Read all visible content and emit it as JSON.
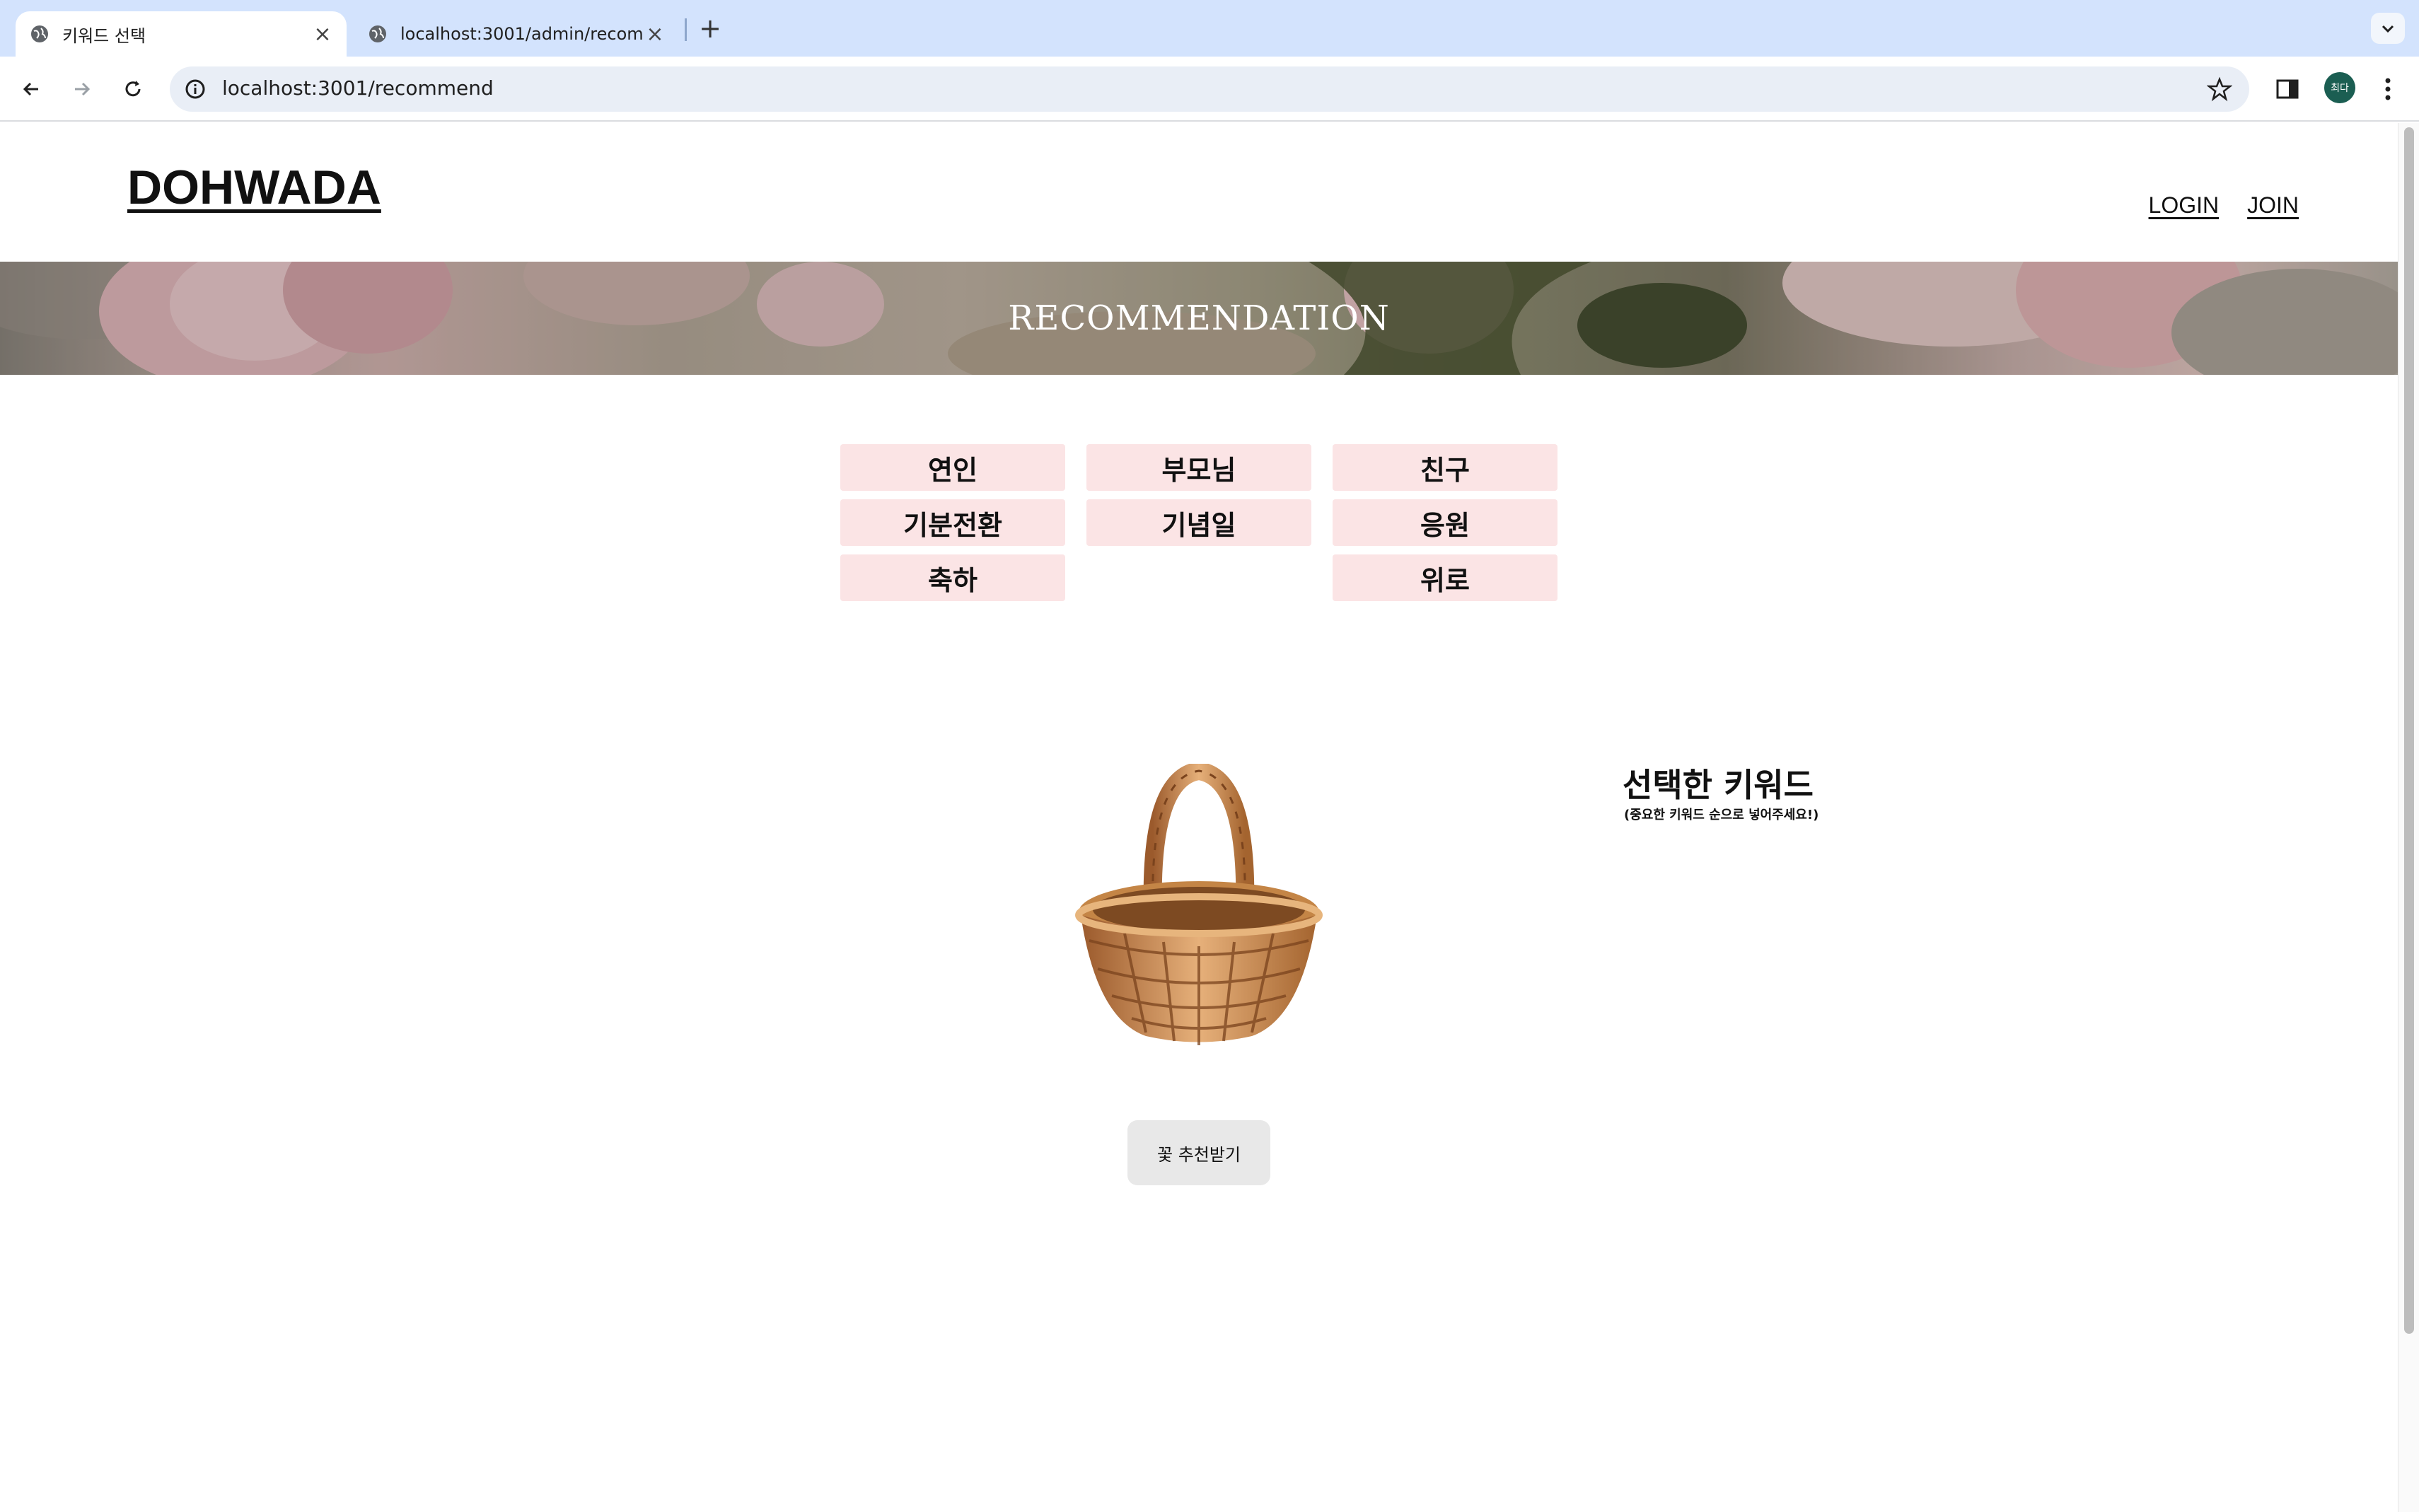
{
  "browser": {
    "tabs": [
      {
        "title": "키워드 선택",
        "active": true
      },
      {
        "title": "localhost:3001/admin/recom",
        "active": false
      }
    ],
    "url": "localhost:3001/recommend",
    "profile_initials": "최다"
  },
  "header": {
    "logo": "DOHWADA",
    "nav": {
      "login": "LOGIN",
      "join": "JOIN"
    }
  },
  "banner": {
    "title": "RECOMMENDATION"
  },
  "keywords": [
    "연인",
    "부모님",
    "친구",
    "기분전환",
    "기념일",
    "응원",
    "축하",
    "위로"
  ],
  "selected": {
    "title": "선택한 키워드",
    "subtitle": "(중요한 키워드 순으로 넣어주세요!)"
  },
  "button": {
    "recommend_label": "꽃 추천받기"
  },
  "colors": {
    "tab_strip": "#d3e3fd",
    "keyword_bg": "#fbe4e5",
    "button_bg": "#e8e8e8",
    "profile_bg": "#1b5e52"
  }
}
